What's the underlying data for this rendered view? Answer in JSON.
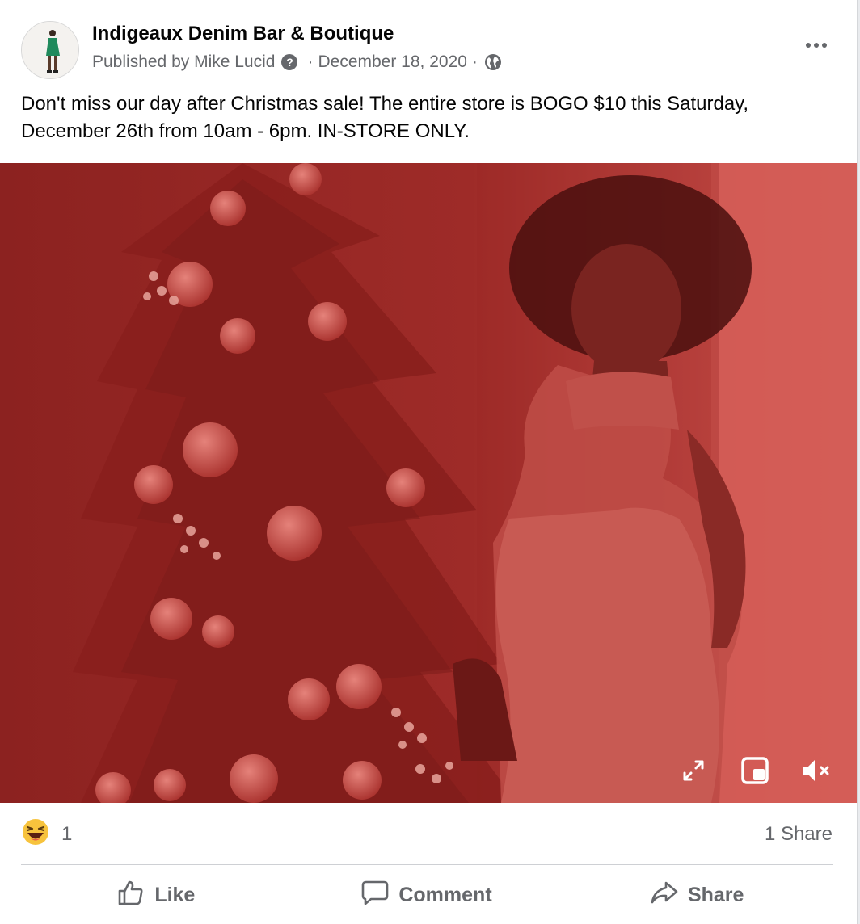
{
  "post": {
    "page_name": "Indigeaux Denim Bar & Boutique",
    "published_by": "Published by Mike Lucid",
    "date": "December 18, 2020",
    "separator": "·",
    "help_icon": "question-circle-icon",
    "audience_icon": "globe-icon",
    "more_icon": "more-horizontal-icon",
    "text": "Don't miss our day after Christmas sale! The entire store is BOGO $10 this Saturday, December 26th from 10am - 6pm. IN-STORE ONLY."
  },
  "video": {
    "tint_color": "#a8302c",
    "controls": [
      {
        "name": "fullscreen-icon"
      },
      {
        "name": "picture-in-picture-icon"
      },
      {
        "name": "muted-speaker-icon"
      }
    ]
  },
  "stats": {
    "reaction_icon": "haha-emoji-icon",
    "reaction_count": "1",
    "shares": "1 Share"
  },
  "actions": {
    "like": "Like",
    "comment": "Comment",
    "share": "Share"
  },
  "colors": {
    "secondary_text": "#65676b",
    "divider": "#ced0d4"
  }
}
